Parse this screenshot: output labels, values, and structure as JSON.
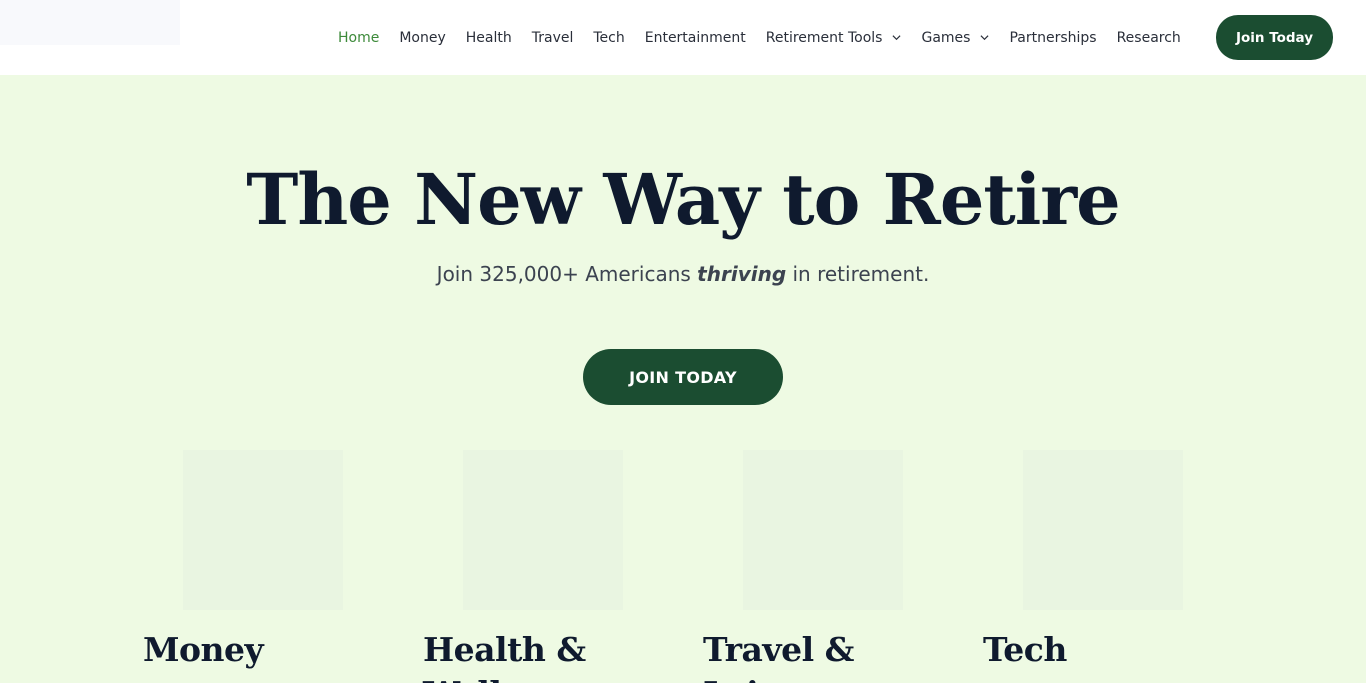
{
  "nav": {
    "items": [
      {
        "label": "Home",
        "active": true,
        "dropdown": false
      },
      {
        "label": "Money",
        "active": false,
        "dropdown": false
      },
      {
        "label": "Health",
        "active": false,
        "dropdown": false
      },
      {
        "label": "Travel",
        "active": false,
        "dropdown": false
      },
      {
        "label": "Tech",
        "active": false,
        "dropdown": false
      },
      {
        "label": "Entertainment",
        "active": false,
        "dropdown": false
      },
      {
        "label": "Retirement Tools",
        "active": false,
        "dropdown": true
      },
      {
        "label": "Games",
        "active": false,
        "dropdown": true
      },
      {
        "label": "Partnerships",
        "active": false,
        "dropdown": false
      },
      {
        "label": "Research",
        "active": false,
        "dropdown": false
      }
    ],
    "join_label": "Join Today"
  },
  "hero": {
    "title": "The New Way to Retire",
    "subtitle_pre": "Join 325,000+ Americans ",
    "subtitle_emphasis": "thriving",
    "subtitle_post": " in retirement.",
    "cta_label": "JOIN TODAY"
  },
  "cards": [
    {
      "title": "Money"
    },
    {
      "title": "Health & Wellness"
    },
    {
      "title": "Travel & Leisure"
    },
    {
      "title": "Tech"
    }
  ],
  "colors": {
    "accent": "#1b4d31",
    "active_nav": "#3d8a3a",
    "background": "#eefae3"
  }
}
